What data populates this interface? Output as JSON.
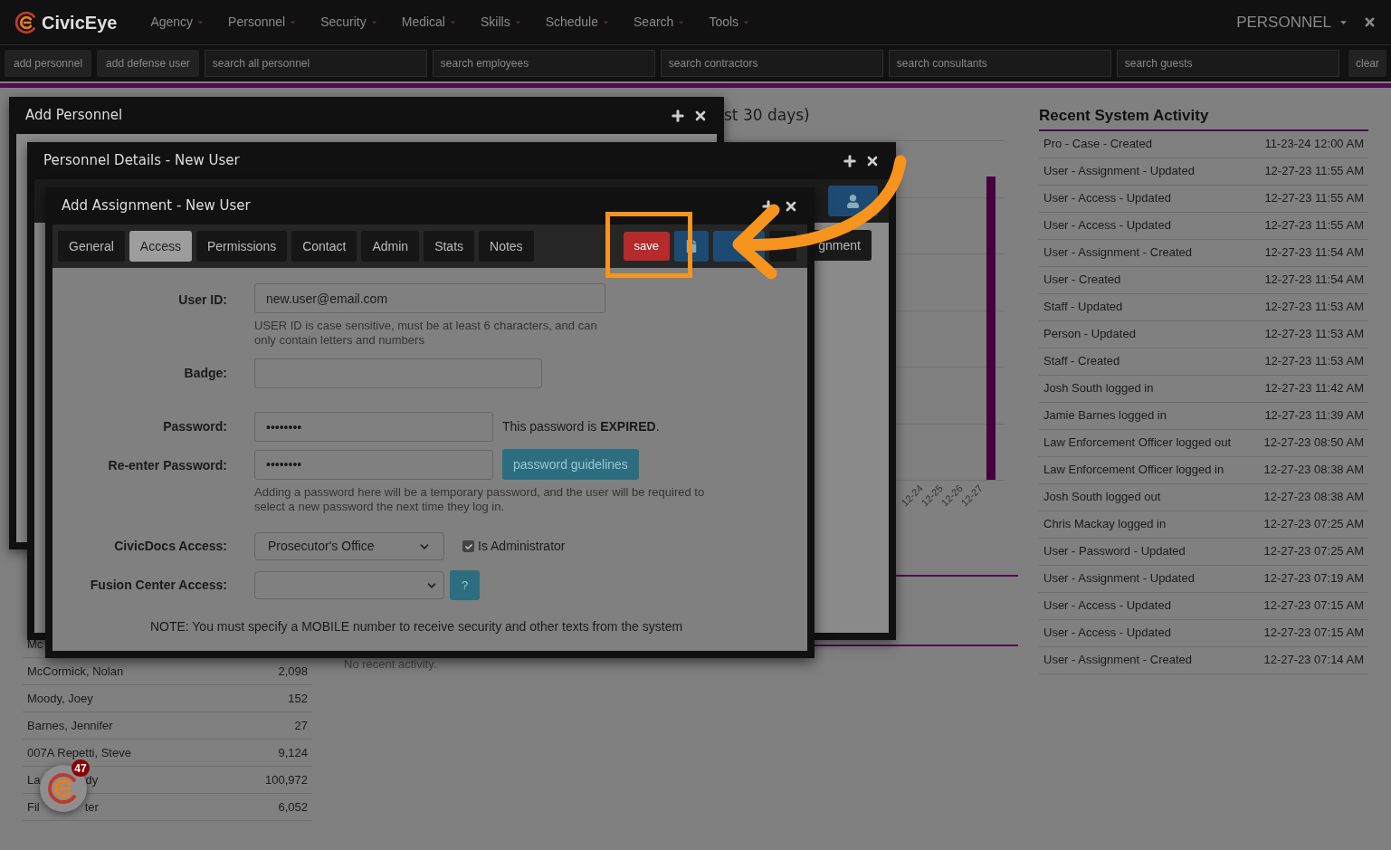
{
  "nav": {
    "logo": "CivicEye",
    "menu": [
      {
        "label": "Agency"
      },
      {
        "label": "Personnel"
      },
      {
        "label": "Security"
      },
      {
        "label": "Medical"
      },
      {
        "label": "Skills"
      },
      {
        "label": "Schedule"
      },
      {
        "label": "Search"
      },
      {
        "label": "Tools"
      }
    ],
    "module": "PERSONNEL"
  },
  "toolbar": {
    "buttons": [
      "add personnel",
      "add defense user"
    ],
    "searches": [
      {
        "placeholder": "search all personnel"
      },
      {
        "placeholder": "search employees"
      },
      {
        "placeholder": "search contractors"
      },
      {
        "placeholder": "search consultants"
      },
      {
        "placeholder": "search guests"
      }
    ],
    "clear": "clear"
  },
  "dashboard": {
    "chart_title": "st 30 days)",
    "x_labels": [
      "12-24",
      "12-25",
      "12-26",
      "12-27"
    ],
    "top_users": [
      {
        "name": "Mc"
      },
      {
        "name": "McCormick, Nolan",
        "count": "2,098"
      },
      {
        "name": "Moody, Joey",
        "count": "152"
      },
      {
        "name": "Barnes, Jennifer",
        "count": "27"
      },
      {
        "name": "007A Repetti, Steve",
        "count": "9,124"
      },
      {
        "name": "La",
        "name_end": "dy",
        "count": "100,972"
      },
      {
        "name": "Fil",
        "name_end": "ter",
        "count": "6,052"
      }
    ],
    "no_activity": "No recent activity."
  },
  "activity": {
    "title": "Recent System Activity",
    "rows": [
      {
        "event": "Pro - Case - Created",
        "time": "11-23-24 12:00 AM"
      },
      {
        "event": "User - Assignment - Updated",
        "time": "12-27-23 11:55 AM"
      },
      {
        "event": "User - Access - Updated",
        "time": "12-27-23 11:55 AM"
      },
      {
        "event": "User - Access - Updated",
        "time": "12-27-23 11:55 AM"
      },
      {
        "event": "User - Assignment - Created",
        "time": "12-27-23 11:54 AM"
      },
      {
        "event": "User - Created",
        "time": "12-27-23 11:54 AM"
      },
      {
        "event": "Staff - Updated",
        "time": "12-27-23 11:53 AM"
      },
      {
        "event": "Person - Updated",
        "time": "12-27-23 11:53 AM"
      },
      {
        "event": "Staff - Created",
        "time": "12-27-23 11:53 AM"
      },
      {
        "event": "Josh South logged in",
        "time": "12-27-23 11:42 AM"
      },
      {
        "event": "Jamie Barnes logged in",
        "time": "12-27-23 11:39 AM"
      },
      {
        "event": "Law Enforcement Officer logged out",
        "time": "12-27-23 08:50 AM"
      },
      {
        "event": "Law Enforcement Officer logged in",
        "time": "12-27-23 08:38 AM"
      },
      {
        "event": "Josh South logged out",
        "time": "12-27-23 08:38 AM"
      },
      {
        "event": "Chris Mackay logged in",
        "time": "12-27-23 07:25 AM"
      },
      {
        "event": "User - Password - Updated",
        "time": "12-27-23 07:25 AM"
      },
      {
        "event": "User - Assignment - Updated",
        "time": "12-27-23 07:19 AM"
      },
      {
        "event": "User - Access - Updated",
        "time": "12-27-23 07:15 AM"
      },
      {
        "event": "User - Access - Updated",
        "time": "12-27-23 07:15 AM"
      },
      {
        "event": "User - Assignment - Created",
        "time": "12-27-23 07:14 AM"
      }
    ]
  },
  "windows": [
    {
      "title": "Add Personnel"
    },
    {
      "title": "Personnel Details - New User",
      "partial_button": "gnment"
    }
  ],
  "assignment": {
    "title": "Add Assignment - New User",
    "tabs": [
      {
        "label": "General",
        "selected": false
      },
      {
        "label": "Access",
        "selected": true
      },
      {
        "label": "Permissions",
        "selected": false
      },
      {
        "label": "Contact",
        "selected": false
      },
      {
        "label": "Admin",
        "selected": false
      },
      {
        "label": "Stats",
        "selected": false
      },
      {
        "label": "Notes",
        "selected": false
      }
    ],
    "save": "save",
    "user_id": {
      "label": "User ID:",
      "value": "new.user@email.com",
      "help": "USER ID is case sensitive, must be at least 6 characters, and can only contain letters and numbers"
    },
    "badge": {
      "label": "Badge:"
    },
    "password": {
      "label": "Password:",
      "value": "••••••••",
      "status": "This password is **EXPIRED**."
    },
    "reenter": {
      "label": "Re-enter Password:",
      "value": "••••••••",
      "button": "password guidelines",
      "help": "Adding a password here will be a temporary password, and the user will be required to select a new password the next time they log in."
    },
    "civicdocs": {
      "label": "CivicDocs Access:",
      "value": "Prosecutor's Office",
      "checkbox": {
        "label": "Is Administrator",
        "checked": true
      }
    },
    "fusion": {
      "label": "Fusion Center Access:",
      "help_button": "?"
    },
    "note": "NOTE: You must specify a MOBILE number to receive security and other texts from the system"
  },
  "notification": {
    "count": "47"
  }
}
